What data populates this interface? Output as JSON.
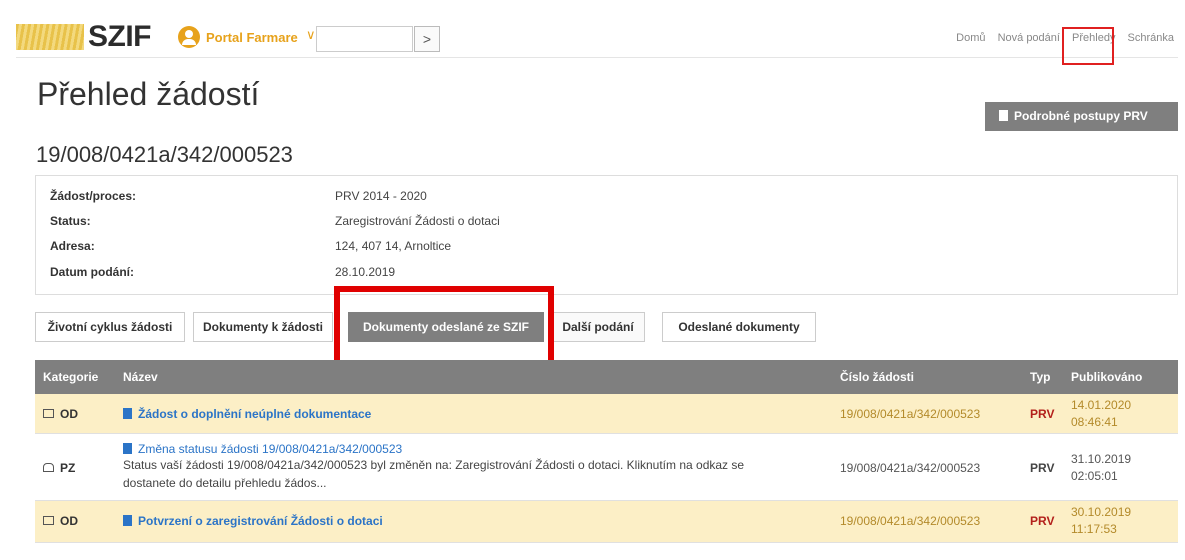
{
  "header": {
    "brand": "SZIF",
    "portal_label": "Portal Farmare",
    "portal_chevron": "∨",
    "search_button": ">",
    "nav": [
      "Domů",
      "Nová podání",
      "Přehledy",
      "Schránka"
    ]
  },
  "page_title": "Přehled žádostí",
  "prv_button": "Podrobné postupy PRV",
  "application_number": "19/008/0421a/342/000523",
  "info": [
    {
      "label": "Žádost/proces:",
      "value": "PRV 2014 - 2020"
    },
    {
      "label": "Status:",
      "value": "Zaregistrování Žádosti o dotaci"
    },
    {
      "label": "Adresa:",
      "value": "124, 407 14, Arnoltice"
    },
    {
      "label": "Datum podání:",
      "value": "28.10.2019"
    }
  ],
  "tabs": [
    "Životní cyklus žádosti",
    "Dokumenty k žádosti",
    "Dokumenty odeslané ze SZIF",
    "Další podání",
    "Odeslané dokumenty"
  ],
  "table": {
    "headers": [
      "Kategorie",
      "Název",
      "Číslo žádosti",
      "Typ",
      "Publikováno"
    ],
    "rows": [
      {
        "category": "OD",
        "title": "Žádost o doplnění neúplné dokumentace",
        "description": "",
        "number": "19/008/0421a/342/000523",
        "type": "PRV",
        "date": "14.01.2020",
        "time": "08:46:41"
      },
      {
        "category": "PZ",
        "title": "Změna statusu žádosti 19/008/0421a/342/000523",
        "description_line1": "Status vaší žádosti 19/008/0421a/342/000523 byl změněn na: Zaregistrování Žádosti o dotaci. Kliknutím na odkaz se",
        "description_line2": "dostanete do detailu přehledu žádos...",
        "number": "19/008/0421a/342/000523",
        "type": "PRV",
        "date": "31.10.2019",
        "time": "02:05:01"
      },
      {
        "category": "OD",
        "title": "Potvrzení o zaregistrování Žádosti o dotaci",
        "description": "",
        "number": "19/008/0421a/342/000523",
        "type": "PRV",
        "date": "30.10.2019",
        "time": "11:17:53"
      }
    ]
  },
  "colors": {
    "accent": "#e7a21b",
    "header_gray": "#7f7f7f",
    "highlight_red": "#e00000",
    "row_yellow": "#fcefc6",
    "link_blue": "#2b74c7"
  }
}
